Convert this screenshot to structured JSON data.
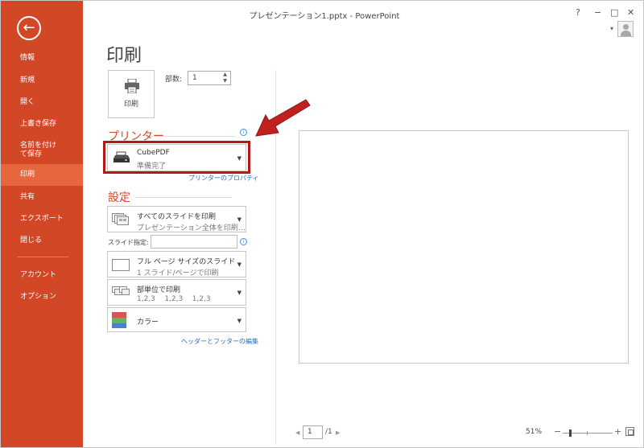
{
  "window": {
    "title": "プレゼンテーション1.pptx - PowerPoint",
    "help": "?",
    "minimize": "−",
    "maximize": "□",
    "close": "✕",
    "account_caret": "▾"
  },
  "sidebar": {
    "back_icon": "←",
    "items": [
      {
        "label": "情報"
      },
      {
        "label": "新規"
      },
      {
        "label": "開く"
      },
      {
        "label": "上書き保存"
      },
      {
        "label": "名前を付けて保存"
      },
      {
        "label": "印刷"
      },
      {
        "label": "共有"
      },
      {
        "label": "エクスポート"
      },
      {
        "label": "閉じる"
      },
      {
        "label": "アカウント"
      },
      {
        "label": "オプション"
      }
    ],
    "active": "印刷"
  },
  "print": {
    "page_title": "印刷",
    "button_label": "印刷",
    "copies_label": "部数:",
    "copies_value": "1"
  },
  "printer": {
    "section_title": "プリンター",
    "name": "CubePDF",
    "status": "準備完了",
    "properties_link": "プリンターのプロパティ"
  },
  "settings": {
    "section_title": "設定",
    "slides_main": "すべてのスライドを印刷",
    "slides_sub": "プレゼンテーション全体を印刷…",
    "range_label": "スライド指定:",
    "range_value": "",
    "layout_main": "フル ページ サイズのスライド",
    "layout_sub": "1 スライド/ページで印刷",
    "collate_main": "部単位で印刷",
    "collate_sub": "1,2,3    1,2,3    1,2,3",
    "color_main": "カラー",
    "header_footer_link": "ヘッダーとフッターの編集"
  },
  "bottom": {
    "prev": "◀",
    "page_value": "1",
    "page_total": "/1",
    "next": "▶",
    "zoom": "51%",
    "zoom_minus": "−",
    "zoom_plus": "+"
  },
  "colors": {
    "accent": "#d24726",
    "active_nav": "#e7663d",
    "highlight_box": "#b31919",
    "arrow": "#c0211f",
    "link": "#2a6ebb"
  }
}
